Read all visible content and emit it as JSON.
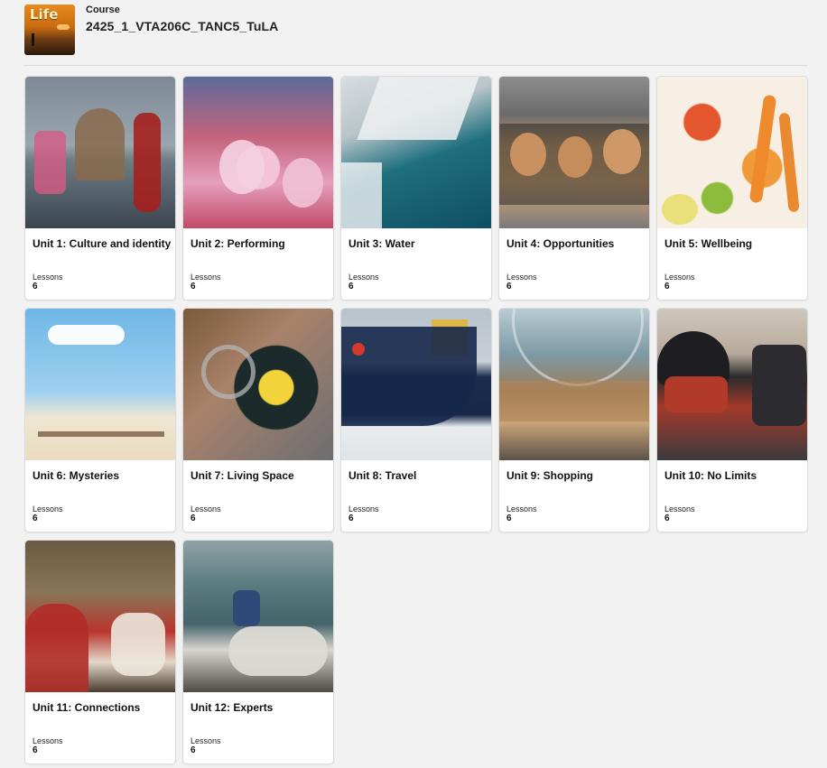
{
  "header": {
    "course_label": "Course",
    "course_title": "2425_1_VTA206C_TANC5_TuLA",
    "logo_text": "Life"
  },
  "units": [
    {
      "title": "Unit 1: Culture and identity",
      "lessons_label": "Lessons",
      "lessons": "6"
    },
    {
      "title": "Unit 2: Performing",
      "lessons_label": "Lessons",
      "lessons": "6"
    },
    {
      "title": "Unit 3: Water",
      "lessons_label": "Lessons",
      "lessons": "6"
    },
    {
      "title": "Unit 4: Opportunities",
      "lessons_label": "Lessons",
      "lessons": "6"
    },
    {
      "title": "Unit 5: Wellbeing",
      "lessons_label": "Lessons",
      "lessons": "6"
    },
    {
      "title": "Unit 6: Mysteries",
      "lessons_label": "Lessons",
      "lessons": "6"
    },
    {
      "title": "Unit 7: Living Space",
      "lessons_label": "Lessons",
      "lessons": "6"
    },
    {
      "title": "Unit 8: Travel",
      "lessons_label": "Lessons",
      "lessons": "6"
    },
    {
      "title": "Unit 9: Shopping",
      "lessons_label": "Lessons",
      "lessons": "6"
    },
    {
      "title": "Unit 10: No Limits",
      "lessons_label": "Lessons",
      "lessons": "6"
    },
    {
      "title": "Unit 11: Connections",
      "lessons_label": "Lessons",
      "lessons": "6"
    },
    {
      "title": "Unit 12: Experts",
      "lessons_label": "Lessons",
      "lessons": "6"
    }
  ]
}
